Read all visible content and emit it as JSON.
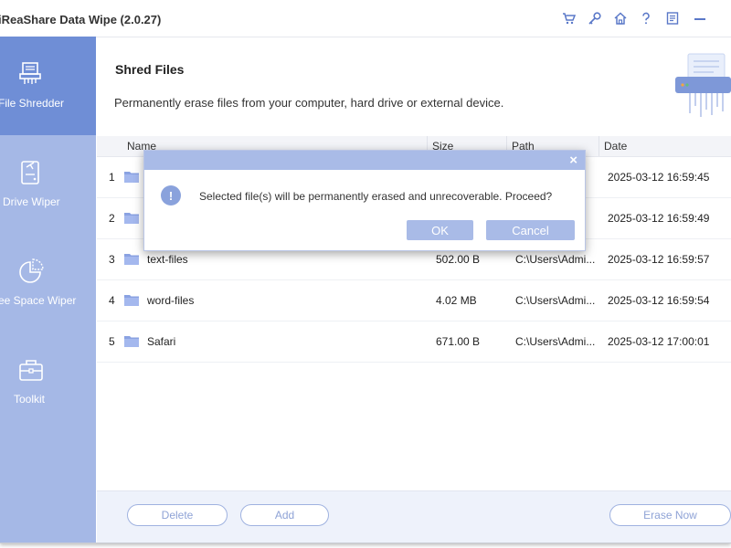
{
  "app": {
    "title": "iReaShare Data Wipe (2.0.27)"
  },
  "titlebar_icons": [
    "cart-icon",
    "key-icon",
    "home-icon",
    "help-icon",
    "feedback-icon",
    "minimize-icon"
  ],
  "sidebar": {
    "items": [
      {
        "label": "File Shredder",
        "icon": "shredder-icon",
        "active": true
      },
      {
        "label": "Drive Wiper",
        "icon": "drive-icon",
        "active": false
      },
      {
        "label": "ee Space Wiper",
        "icon": "pie-icon",
        "active": false
      },
      {
        "label": "Toolkit",
        "icon": "toolbox-icon",
        "active": false
      }
    ]
  },
  "main": {
    "title": "Shred Files",
    "description": "Permanently erase files from your computer, hard drive or external device."
  },
  "table": {
    "columns": [
      "Name",
      "Size",
      "Path",
      "Date"
    ],
    "rows": [
      {
        "index": "1",
        "name": "",
        "size": "",
        "path": "",
        "date": "2025-03-12 16:59:45"
      },
      {
        "index": "2",
        "name": "",
        "size": "",
        "path": "",
        "date": "2025-03-12 16:59:49"
      },
      {
        "index": "3",
        "name": "text-files",
        "size": "502.00 B",
        "path": "C:\\Users\\Admi...",
        "date": "2025-03-12 16:59:57"
      },
      {
        "index": "4",
        "name": "word-files",
        "size": "4.02 MB",
        "path": "C:\\Users\\Admi...",
        "date": "2025-03-12 16:59:54"
      },
      {
        "index": "5",
        "name": "Safari",
        "size": "671.00 B",
        "path": "C:\\Users\\Admi...",
        "date": "2025-03-12 17:00:01"
      }
    ]
  },
  "footer": {
    "delete_label": "Delete",
    "add_label": "Add",
    "erase_label": "Erase Now"
  },
  "dialog": {
    "close": "×",
    "info": "!",
    "message": "Selected file(s) will be permanently erased and unrecoverable. Proceed?",
    "ok_label": "OK",
    "cancel_label": "Cancel"
  },
  "colors": {
    "accent": "#6f8ed6",
    "sidebar": "#a5b8e6",
    "dialog_bar": "#a9bbe7"
  }
}
